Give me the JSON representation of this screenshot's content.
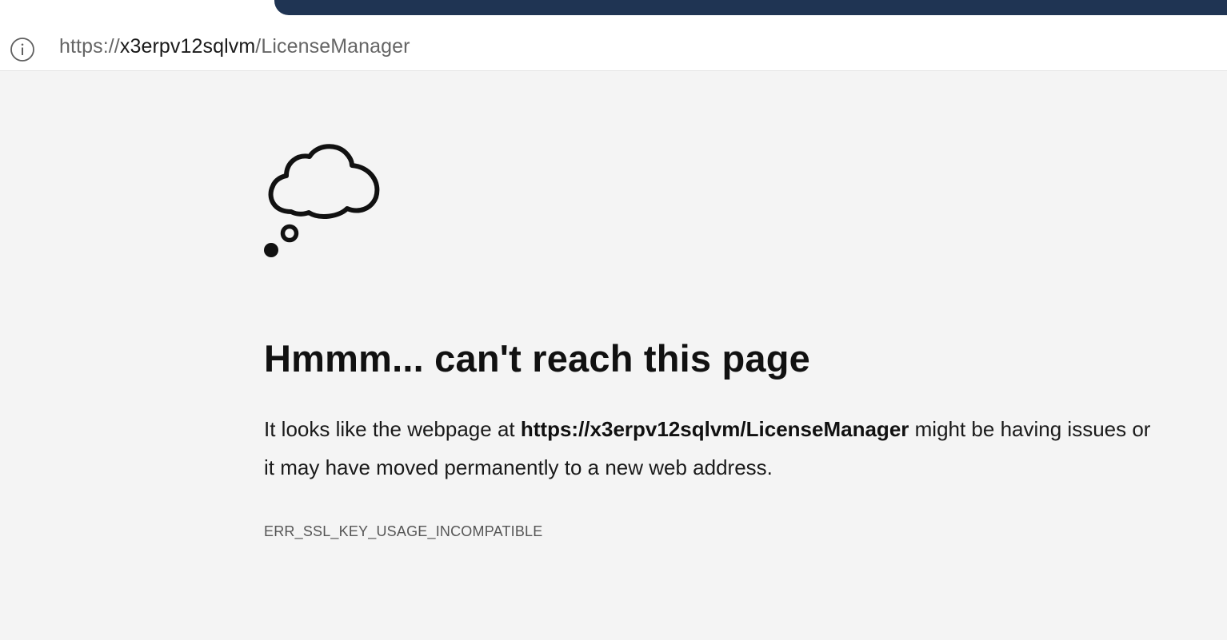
{
  "browser": {
    "url_prefix": "https://",
    "url_host": "x3erpv12sqlvm",
    "url_path": "/LicenseManager",
    "info_icon": "info-circle-icon"
  },
  "error_page": {
    "icon": "thought-bubble-icon",
    "heading": "Hmmm... can't reach this page",
    "message_before": "It looks like the webpage at ",
    "message_url": "https://x3erpv12sqlvm/LicenseManager",
    "message_after_line1": " might be having issues or",
    "message_line2": "it may have moved permanently to a new web address.",
    "error_code": "ERR_SSL_KEY_USAGE_INCOMPATIBLE"
  },
  "colors": {
    "tab_bar": "#1f3453",
    "page_background": "#f4f4f4",
    "text": "#111111"
  }
}
